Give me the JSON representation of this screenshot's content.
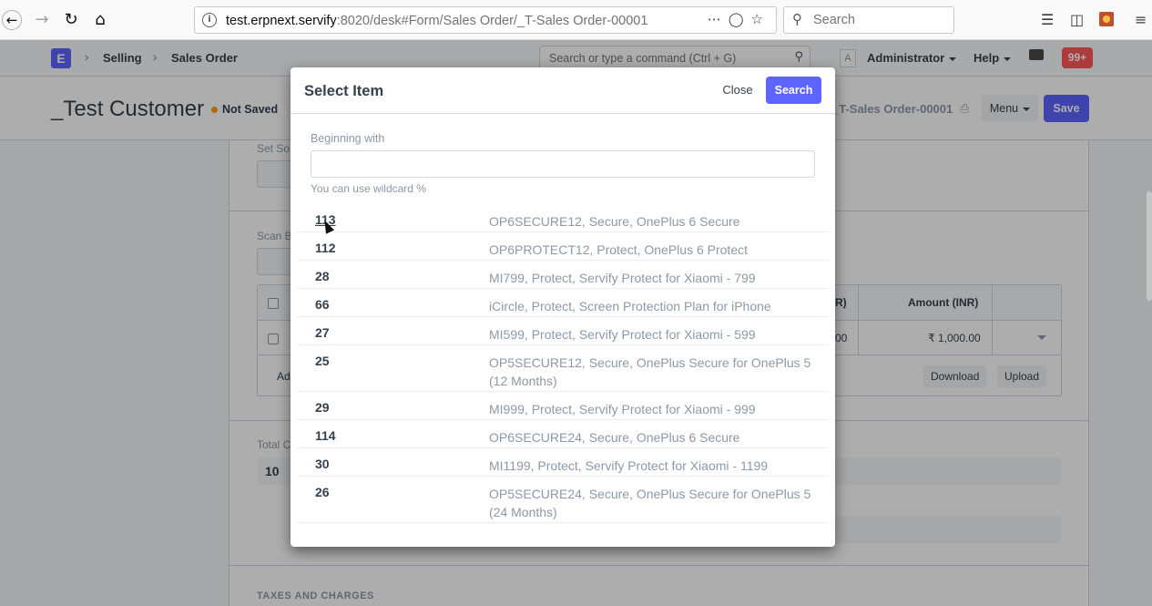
{
  "browser": {
    "url_host": "test.erpnext.servify",
    "url_rest": ":8020/desk#Form/Sales Order/_T-Sales Order-00001",
    "search_placeholder": "Search"
  },
  "app": {
    "logo": "E",
    "breadcrumbs": [
      "Selling",
      "Sales Order"
    ],
    "awesome_bar_placeholder": "Search or type a command (Ctrl + G)",
    "avatar_letter": "A",
    "user_menu": "Administrator",
    "help_menu": "Help",
    "notifications": "99+",
    "page_title": "_Test Customer",
    "status": "Not Saved",
    "doc_name": "_T-Sales Order-00001",
    "menu_label": "Menu",
    "save_label": "Save",
    "form": {
      "set_source_label": "Set So",
      "scan_barcode_label": "Scan B",
      "grid_amount_header": "Amount (INR)",
      "grid_rate_header_fragment": "R)",
      "grid_rate_value_fragment": "00",
      "grid_amount_value": "₹ 1,000.00",
      "add_row_fragment": "Ad",
      "download_label": "Download",
      "upload_label": "Upload",
      "total_label_fragment": "Total C",
      "total_value": "10",
      "taxes_caption": "TAXES AND CHARGES"
    }
  },
  "modal": {
    "title": "Select Item",
    "close_label": "Close",
    "search_label": "Search",
    "field_label": "Beginning with",
    "field_value": "",
    "help_text": "You can use wildcard %",
    "results": [
      {
        "name": "113",
        "description": "OP6SECURE12, Secure, OnePlus 6 Secure"
      },
      {
        "name": "112",
        "description": "OP6PROTECT12, Protect, OnePlus 6 Protect"
      },
      {
        "name": "28",
        "description": "MI799, Protect, Servify Protect for Xiaomi - 799"
      },
      {
        "name": "66",
        "description": "iCircle, Protect, Screen Protection Plan for iPhone"
      },
      {
        "name": "27",
        "description": "MI599, Protect, Servify Protect for Xiaomi - 599"
      },
      {
        "name": "25",
        "description": "OP5SECURE12, Secure, OnePlus Secure for OnePlus 5 (12 Months)"
      },
      {
        "name": "29",
        "description": "MI999, Protect, Servify Protect for Xiaomi - 999"
      },
      {
        "name": "114",
        "description": "OP6SECURE24, Secure, OnePlus 6 Secure"
      },
      {
        "name": "30",
        "description": "MI1199, Protect, Servify Protect for Xiaomi - 1199"
      },
      {
        "name": "26",
        "description": "OP5SECURE24, Secure, OnePlus Secure for OnePlus 5 (24 Months)"
      }
    ]
  },
  "colors": {
    "primary": "#5e64ff",
    "badge": "#ff5858",
    "not_saved_dot": "#ffa00a"
  }
}
